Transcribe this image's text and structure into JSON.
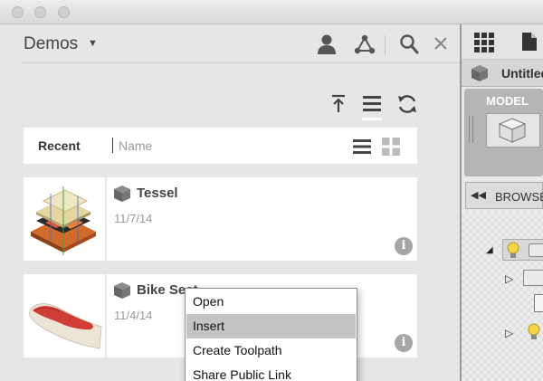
{
  "window": {
    "traffic_lights": [
      "close",
      "minimize",
      "zoom"
    ]
  },
  "data_panel": {
    "project_title": "Demos",
    "header_icons": [
      "user-icon",
      "network-icon",
      "search-icon",
      "close-icon"
    ],
    "toolbar_icons": [
      "upload-icon",
      "list-view-icon",
      "refresh-icon"
    ],
    "sort": {
      "recent_label": "Recent",
      "name_label": "Name"
    },
    "view_icons": [
      "list-view-icon",
      "grid-view-icon"
    ],
    "files": [
      {
        "title": "Tessel",
        "date": "11/7/14"
      },
      {
        "title": "Bike Seat",
        "date": "11/4/14"
      }
    ]
  },
  "context_menu": {
    "items": [
      "Open",
      "Insert",
      "Create Toolpath",
      "Share Public Link"
    ],
    "highlighted": "Insert"
  },
  "right_pane": {
    "document_tab": "Untitled",
    "workspace_label": "MODEL",
    "browser_label": "BROWSER"
  },
  "colors": {
    "accent_red": "#e03c31",
    "panel_bg": "#e6e6e6",
    "highlight": "#c4c4c4"
  }
}
